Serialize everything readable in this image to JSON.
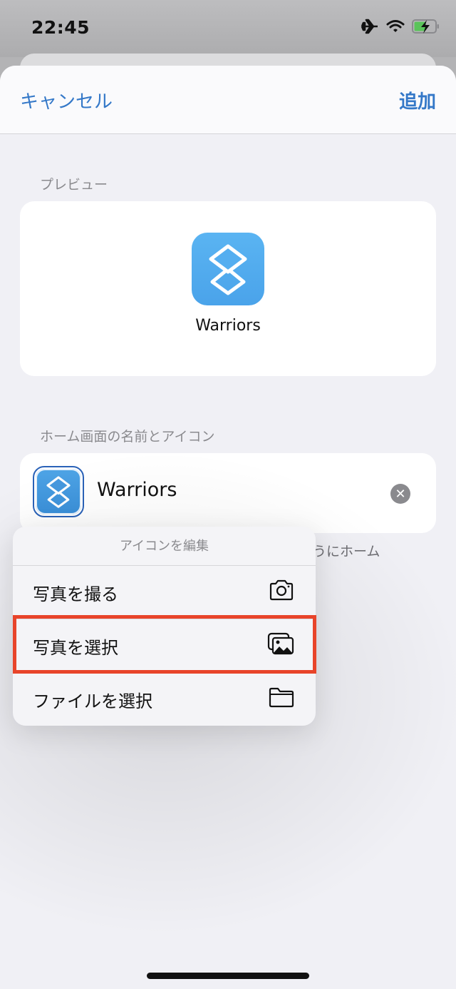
{
  "status_bar": {
    "time": "22:45",
    "icons": [
      "airplane-icon",
      "wifi-icon",
      "battery-charging-icon"
    ],
    "battery_color": "#5ac45a"
  },
  "navbar": {
    "cancel_label": "キャンセル",
    "add_label": "追加",
    "accent_color": "#3478c8"
  },
  "preview": {
    "section_label": "プレビュー",
    "app_name": "Warriors",
    "icon": "shortcuts-layers-icon"
  },
  "home_screen": {
    "section_label": "ホーム画面の名前とアイコン",
    "name_value": "Warriors",
    "clear_label": "✕",
    "footnote_visible": "ようにホーム"
  },
  "edit_icon_menu": {
    "title": "アイコンを編集",
    "items": [
      {
        "label": "写真を撮る",
        "icon": "camera-icon"
      },
      {
        "label": "写真を選択",
        "icon": "photos-icon",
        "highlighted": true
      },
      {
        "label": "ファイルを選択",
        "icon": "folder-icon"
      }
    ],
    "highlight_color": "#e8442a"
  }
}
